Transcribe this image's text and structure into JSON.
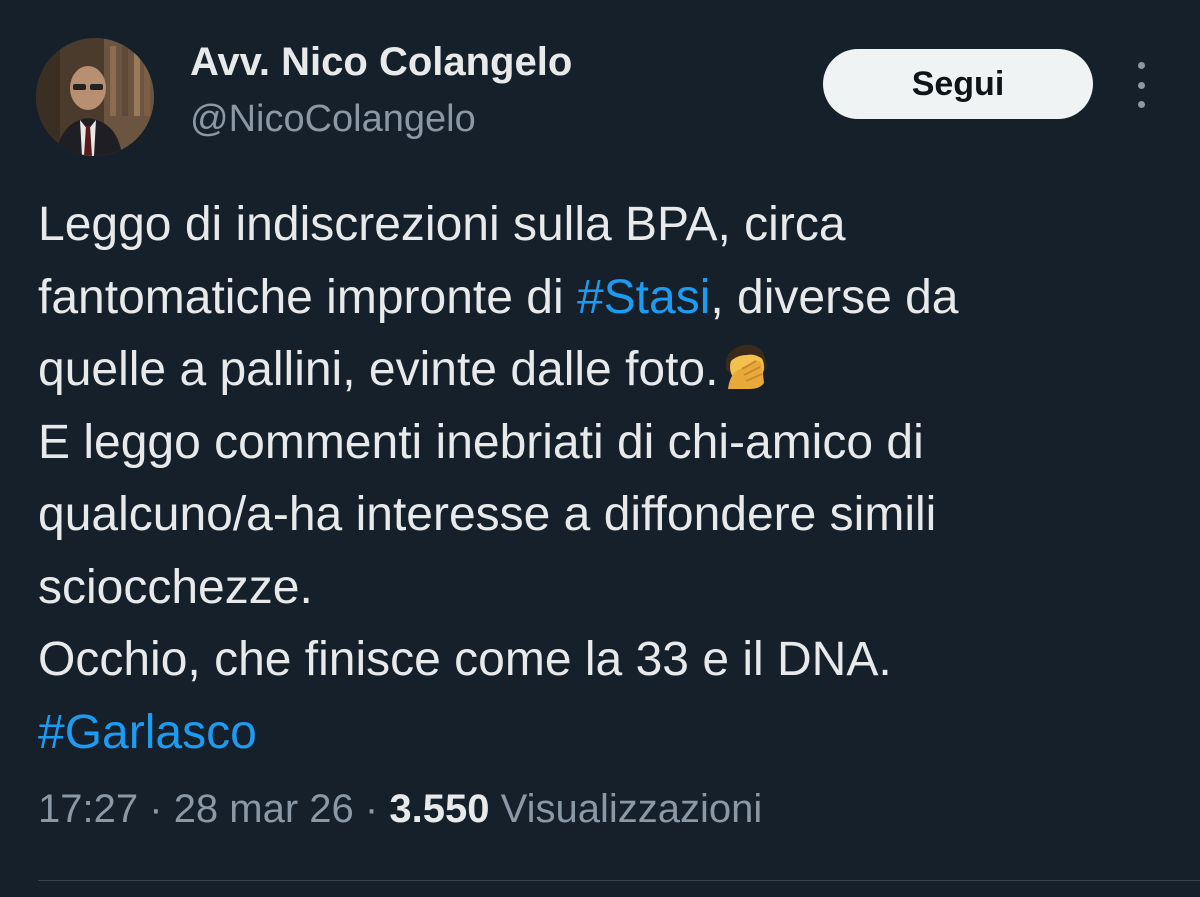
{
  "author": {
    "display_name": "Avv. Nico Colangelo",
    "handle": "@NicoColangelo"
  },
  "follow_label": "Segui",
  "tweet": {
    "line1": "Leggo di indiscrezioni sulla BPA, circa",
    "line2_before": "fantomatiche impronte di ",
    "line2_hashtag": "#Stasi",
    "line2_after": ", diverse da",
    "line3": "quelle a pallini, evinte dalle foto.",
    "line3_emoji": "face-palm-emoji",
    "line4": "E leggo commenti inebriati di chi-amico di",
    "line5": "qualcuno/a-ha interesse a diffondere simili",
    "line6": "sciocchezze.",
    "line7": "Occhio, che finisce come la 33 e il DNA.",
    "line8_hashtag": "#Garlasco"
  },
  "meta": {
    "time": "17:27",
    "separator": "·",
    "date": "28 mar 26",
    "views_count": "3.550",
    "views_label": "Visualizzazioni"
  },
  "colors": {
    "background": "#15202b",
    "text": "#e7e9ea",
    "secondary": "#8b98a5",
    "link": "#1d9bf0",
    "button_bg": "#eff3f4"
  },
  "icons": {
    "more": "more-vertical-icon",
    "avatar": "profile-photo"
  }
}
